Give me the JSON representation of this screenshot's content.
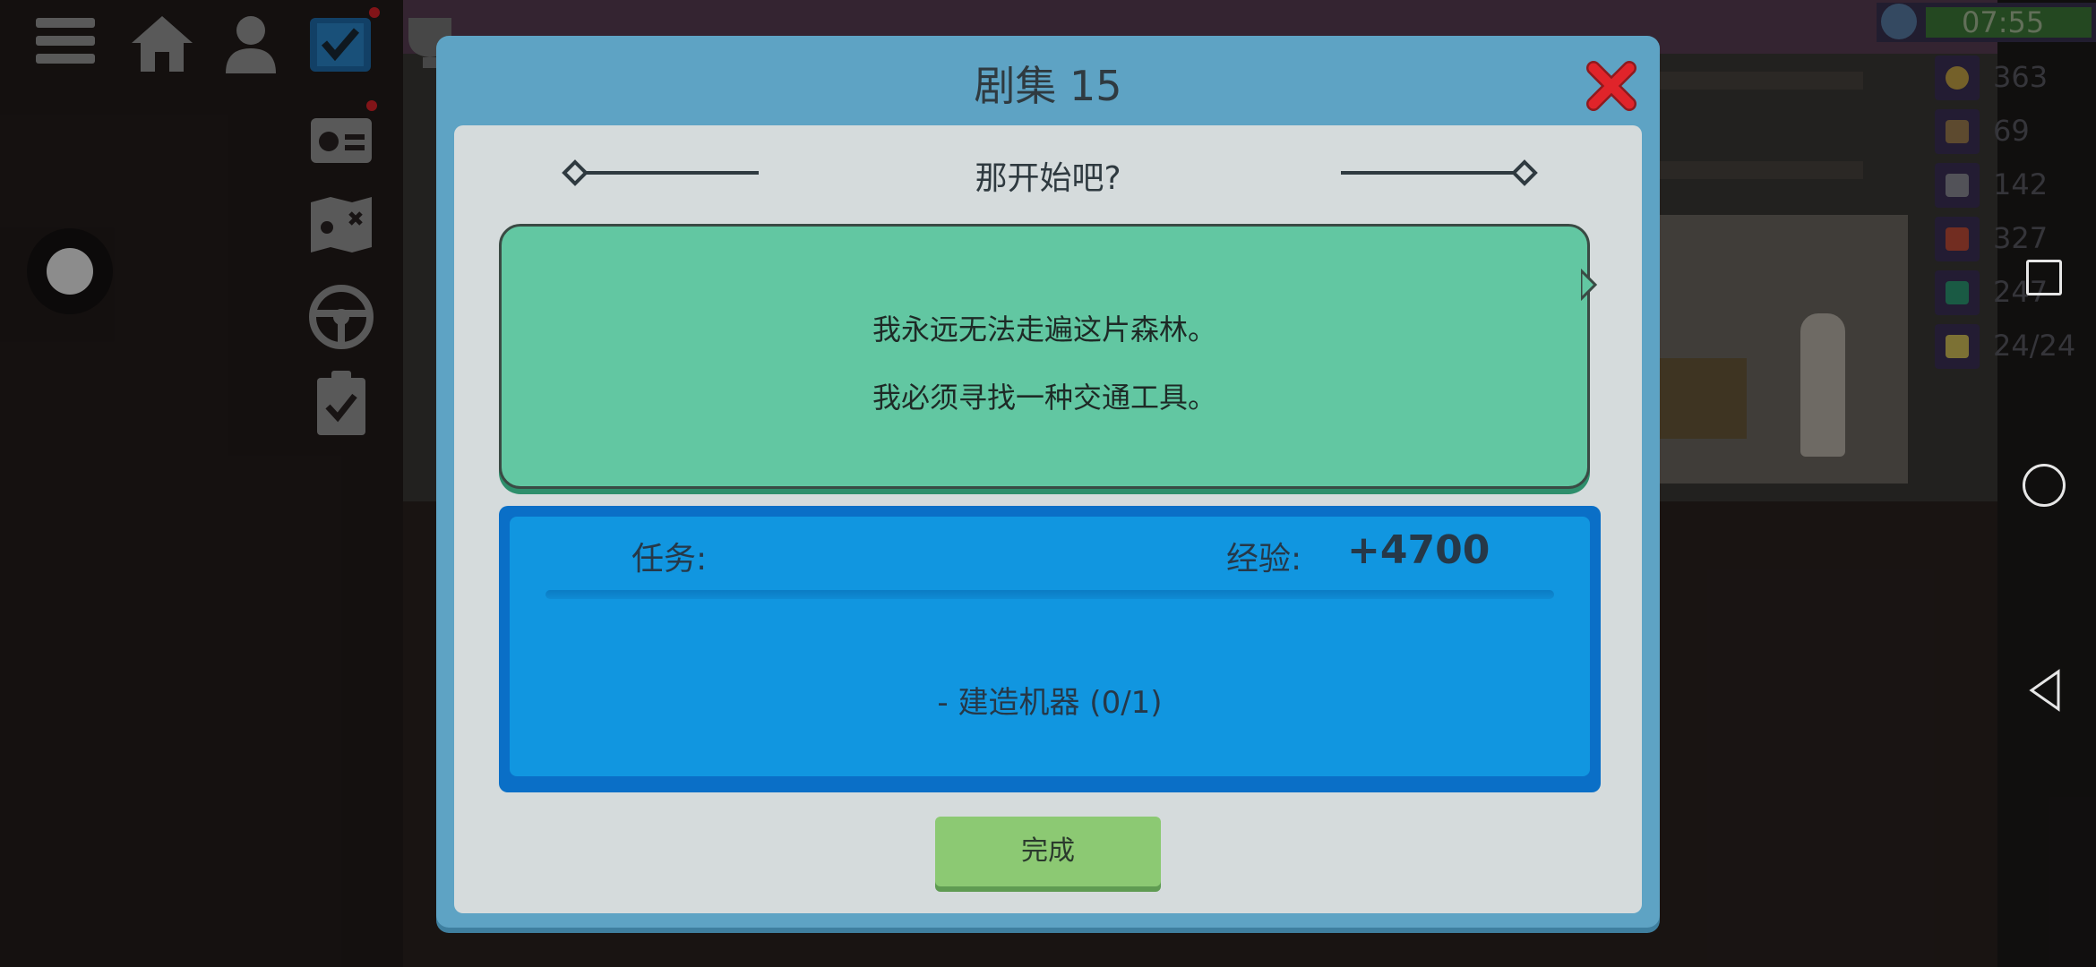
{
  "status": {
    "time": "07:55"
  },
  "resources": [
    {
      "icon": "coin-icon",
      "value": "363",
      "color": "#c9a548"
    },
    {
      "icon": "wood-icon",
      "value": "69",
      "color": "#a08052"
    },
    {
      "icon": "metal-icon",
      "value": "142",
      "color": "#8e8e98"
    },
    {
      "icon": "book-icon",
      "value": "327",
      "color": "#c44e3a"
    },
    {
      "icon": "circuit-icon",
      "value": "247",
      "color": "#2e9b76"
    },
    {
      "icon": "battery-icon",
      "value": "24/24",
      "color": "#d6c35a"
    }
  ],
  "dialog": {
    "title": "剧集 15",
    "subtitle": "那开始吧?",
    "message_lines": [
      "我永远无法走遍这片森林。",
      "我必须寻找一种交通工具。"
    ],
    "task_label": "任务:",
    "xp_label": "经验:",
    "xp_value": "+4700",
    "task_item": "- 建造机器 (0/1)",
    "done_button": "完成"
  },
  "colors": {
    "dialog_frame": "#5ea3c4",
    "bubble": "#62c7a2",
    "task_box": "#1196e0",
    "done_button": "#8cc973",
    "close_red": "#e0242a"
  }
}
